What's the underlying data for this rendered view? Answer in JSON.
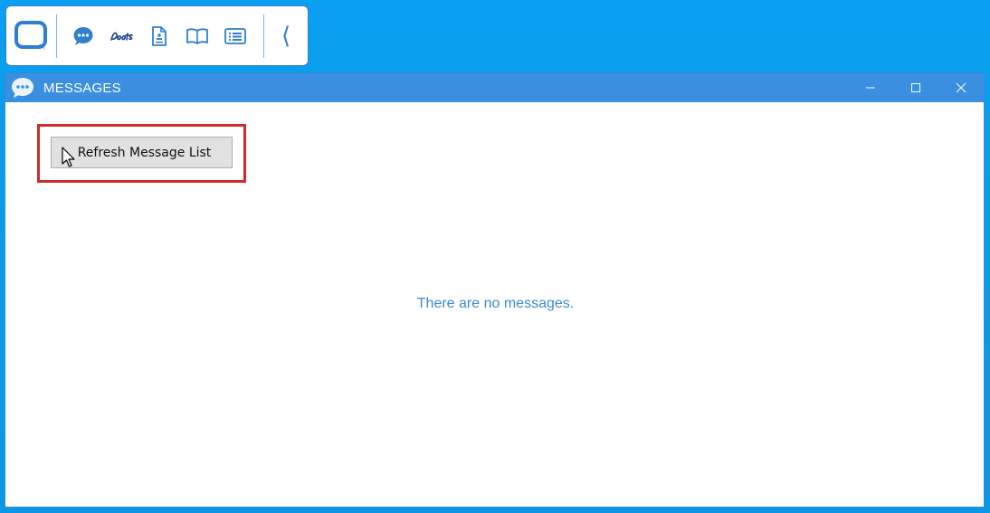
{
  "toolbar": {
    "icons": [
      "app-logo-icon",
      "messages-icon",
      "boots-logo-icon",
      "document-icon",
      "book-icon",
      "list-icon"
    ],
    "collapse_label": "⟨"
  },
  "window": {
    "title": "MESSAGES",
    "refresh_button_label": "Refresh Message List",
    "empty_text": "There are no messages."
  },
  "colors": {
    "desktop": "#0a9ff0",
    "titlebar": "#3a8fe0",
    "accent": "#2f7fd1",
    "highlight": "#d22b2b"
  }
}
